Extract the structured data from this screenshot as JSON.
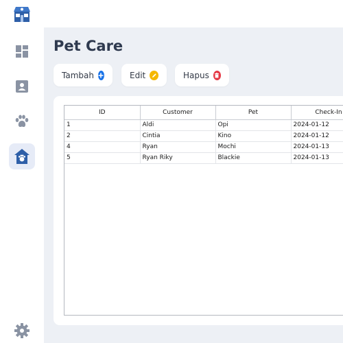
{
  "main": {
    "title": "Pet Care",
    "buttons": {
      "add": "Tambah",
      "edit": "Edit",
      "delete": "Hapus"
    }
  },
  "table": {
    "headers": [
      "ID",
      "Customer",
      "Pet",
      "Check-In"
    ],
    "rows": [
      [
        "1",
        "Aldi",
        "Opi",
        "2024-01-12"
      ],
      [
        "2",
        "Cintia",
        "Kino",
        "2024-01-12"
      ],
      [
        "4",
        "Ryan",
        "Mochi",
        "2024-01-13"
      ],
      [
        "5",
        "Ryan Riky",
        "Blackie",
        "2024-01-13"
      ]
    ]
  },
  "colors": {
    "add_icon": "#1a73e8",
    "edit_icon": "#f5b800",
    "delete_icon": "#e53946",
    "nav_icon": "#8a93a3",
    "active_icon": "#2e5fa8"
  },
  "icons": {
    "logo": "pet-shop-icon",
    "nav": [
      "dashboard-icon",
      "customer-icon",
      "paw-icon",
      "pet-hotel-icon"
    ],
    "settings": "gear-icon"
  }
}
